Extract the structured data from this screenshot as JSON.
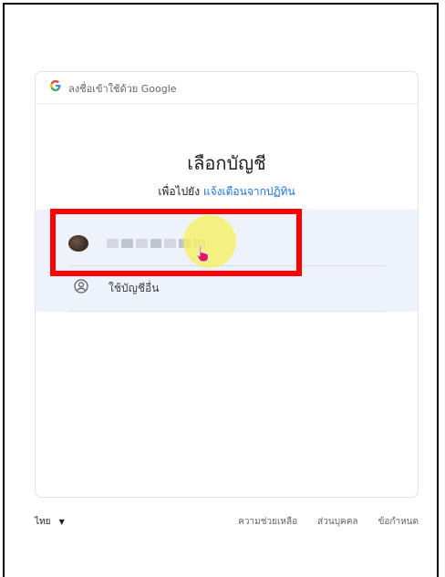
{
  "header": {
    "text": "ลงชื่อเข้าใช้ด้วย Google",
    "logo": "G"
  },
  "main": {
    "title": "เลือกบัญชี",
    "subtitle_prefix": "เพื่อไปยัง",
    "subtitle_app": "แจ้งเตือนจากปฏิทิน"
  },
  "accounts": {
    "other_label": "ใช้บัญชีอื่น"
  },
  "footer": {
    "language": "ไทย",
    "language_caret": "▼",
    "links": [
      "ความช่วยเหลือ",
      "ส่วนบุคคล",
      "ข้อกำหนด"
    ]
  },
  "colors": {
    "highlight": "#ff0000",
    "link": "#1a73e8",
    "selected_bg": "#eef2fb"
  },
  "icons": [
    "google-g-icon",
    "person-circle-icon",
    "hand-cursor-icon",
    "dropdown-caret-icon"
  ]
}
